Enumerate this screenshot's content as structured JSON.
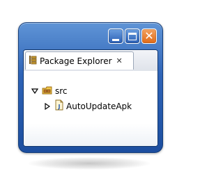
{
  "window": {
    "controls": {
      "minimize_icon": "minimize-icon",
      "maximize_icon": "maximize-icon",
      "close_icon": "close-icon",
      "close_glyph": "✕"
    }
  },
  "view": {
    "tab_label": "Package Explorer",
    "tab_icon": "package-explorer-icon",
    "tab_close_glyph": "✕"
  },
  "tree": {
    "items": [
      {
        "label": "src",
        "icon": "package-folder-icon",
        "expanded": true
      },
      {
        "label": "AutoUpdateApk",
        "icon": "java-file-icon",
        "expanded": false
      }
    ]
  },
  "colors": {
    "frame": "#2f64b7",
    "close_button": "#e06a17",
    "content_bg": "#ffffff"
  }
}
